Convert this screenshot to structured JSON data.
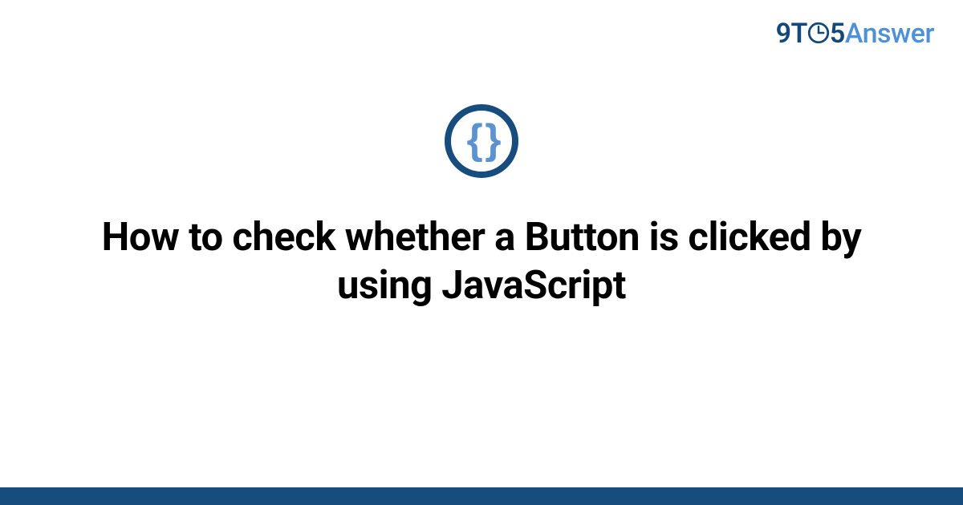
{
  "brand": {
    "part_nine": "9",
    "part_t": "T",
    "part_five": "5",
    "part_answer": "Answer"
  },
  "category_icon": {
    "name": "code-braces-icon",
    "glyph": "{ }"
  },
  "main": {
    "title": "How to check whether a Button is clicked by using JavaScript"
  },
  "colors": {
    "brand_dark": "#164c7e",
    "brand_light": "#4f91d6",
    "icon_brace": "#5b92cf"
  }
}
